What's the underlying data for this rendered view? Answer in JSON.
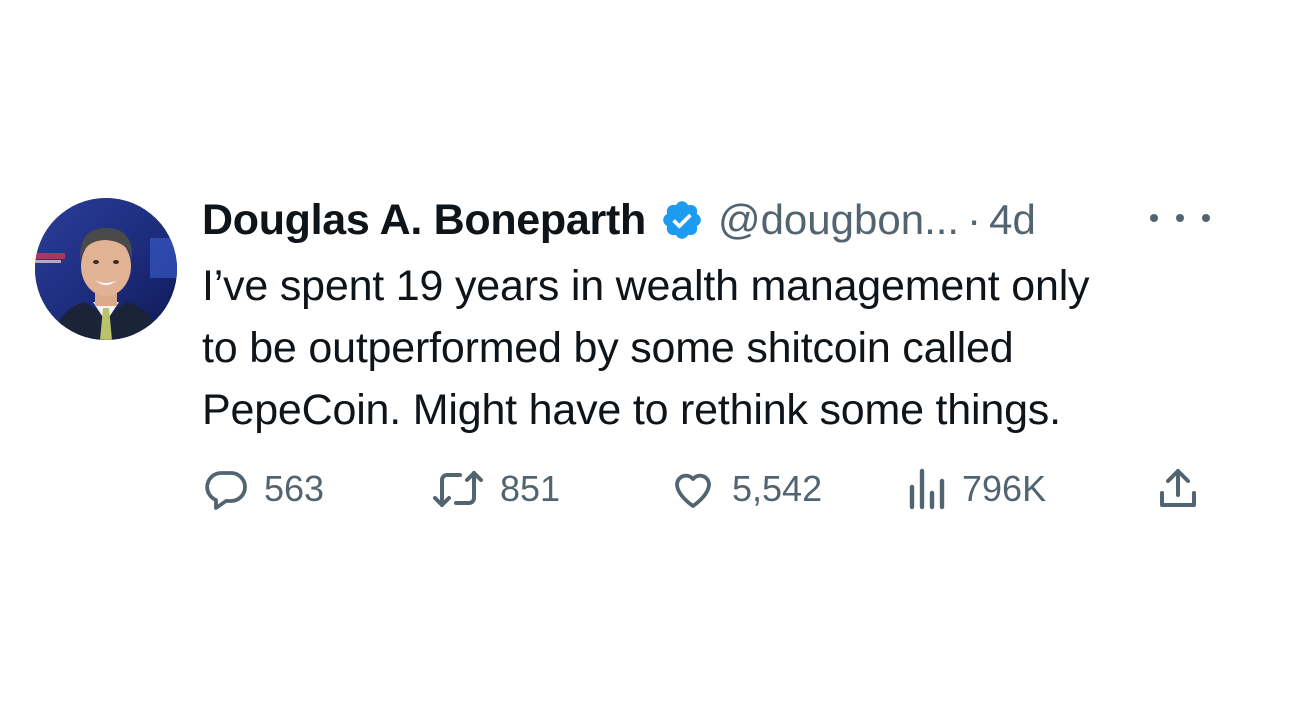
{
  "tweet": {
    "author": {
      "display_name": "Douglas A. Boneparth",
      "handle": "@dougbon...",
      "separator": "·",
      "time": "4d",
      "verified_icon": "verified-badge-icon",
      "avatar": "avatar-photo"
    },
    "text_lines": [
      "I’ve spent 19 years in wealth management only",
      "to be outperformed by some shitcoin called",
      "PepeCoin. Might have to rethink some things."
    ],
    "actions": {
      "replies": "563",
      "retweets": "851",
      "likes": "5,542",
      "views": "796K"
    },
    "icons": {
      "reply": "reply-icon",
      "retweet": "retweet-icon",
      "like": "heart-icon",
      "views": "views-chart-icon",
      "share": "share-icon",
      "more": "more-icon"
    },
    "colors": {
      "verified": "#1d9bf0",
      "secondary_text": "#536471",
      "primary_text": "#0f1419"
    }
  }
}
